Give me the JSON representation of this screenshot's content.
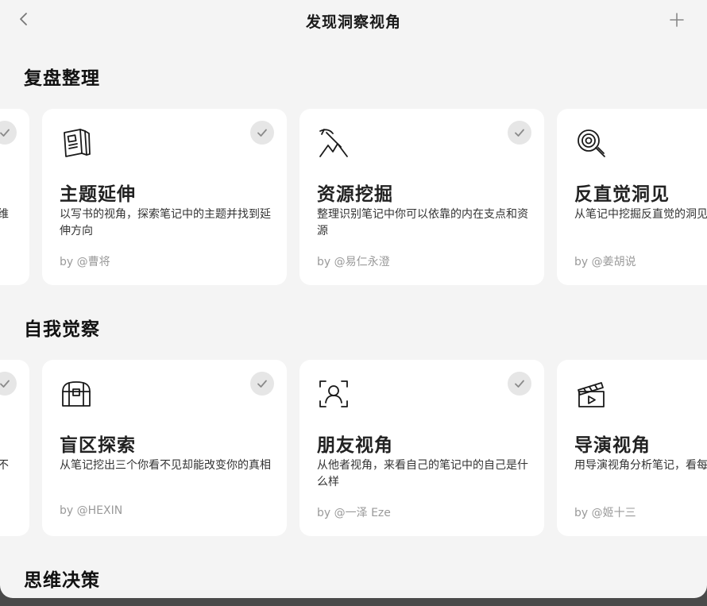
{
  "header": {
    "title": "发现洞察视角"
  },
  "sections": [
    {
      "title": "复盘整理",
      "cards": [
        {
          "name": "",
          "desc": "...维\n",
          "author": "",
          "icon": "partial"
        },
        {
          "name": "主题延伸",
          "desc": "以写书的视角，探索笔记中的主题并找到延伸方向",
          "author": "by @曹将",
          "icon": "book-icon"
        },
        {
          "name": "资源挖掘",
          "desc": "整理识别笔记中你可以依靠的内在支点和资源",
          "author": "by @易仁永澄",
          "icon": "pickaxe-icon"
        },
        {
          "name": "反直觉洞见",
          "desc": "从笔记中挖掘反直觉的洞见，行动说透道理",
          "author": "by @姜胡说",
          "icon": "magnifier-icon"
        }
      ]
    },
    {
      "title": "自我觉察",
      "cards": [
        {
          "name": "",
          "desc": "不",
          "author": "",
          "icon": "partial"
        },
        {
          "name": "盲区探索",
          "desc": "从笔记挖出三个你看不见却能改变你的真相",
          "author": "by @HEXIN",
          "icon": "treasure-chest-icon"
        },
        {
          "name": "朋友视角",
          "desc": "从他者视角，来看自己的笔记中的自己是什么样",
          "author": "by @一泽 Eze",
          "icon": "face-scan-icon"
        },
        {
          "name": "导演视角",
          "desc": "用导演视角分析笔记，看每个剧本",
          "author": "by @姬十三",
          "icon": "clapperboard-icon"
        }
      ]
    },
    {
      "title": "思维决策",
      "cards": []
    }
  ],
  "partial_texts": {
    "row1": "维",
    "row2": "不"
  }
}
